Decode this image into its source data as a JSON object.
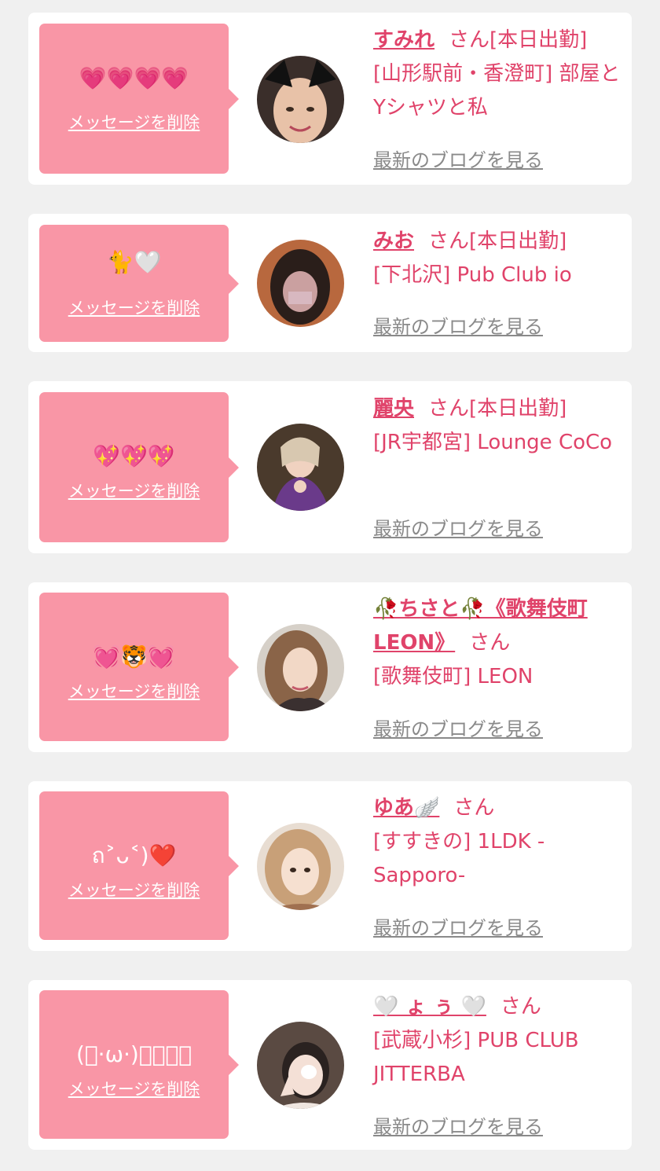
{
  "accent_color": "#e0436a",
  "bubble_color": "#f996a6",
  "cards": [
    {
      "message": "💗💗💗💗",
      "delete_label": "メッセージを削除",
      "name": "すみれ",
      "honorific": "さん",
      "tag": "[本日出勤]",
      "shop": "[山形駅前・香澄町] 部屋とYシャツと私",
      "blog_link": "最新のブログを見る"
    },
    {
      "message": "🐈🤍",
      "delete_label": "メッセージを削除",
      "name": "みお",
      "honorific": "さん",
      "tag": "[本日出勤]",
      "shop": "[下北沢] Pub Club io",
      "blog_link": "最新のブログを見る"
    },
    {
      "message": "💖💖💖",
      "delete_label": "メッセージを削除",
      "name": "麗央",
      "honorific": "さん",
      "tag": "[本日出勤]",
      "shop": "[JR宇都宮] Lounge CoCo",
      "blog_link": "最新のブログを見る"
    },
    {
      "message": "💓🐯💓",
      "delete_label": "メッセージを削除",
      "name": "🥀ちさと🥀《歌舞伎町LEON》",
      "honorific": "さん",
      "tag": "",
      "shop": "[歌舞伎町] LEON",
      "blog_link": "最新のブログを見る"
    },
    {
      "message": "ถ˃ᴗ˂)❤️",
      "delete_label": "メッセージを削除",
      "name": "ゆあ🪽",
      "honorific": "さん",
      "tag": "",
      "shop": "[すすきの] 1LDK -Sapporo-",
      "blog_link": "最新のブログを見る"
    },
    {
      "message": "(ﾟ·ω·)ﾟﾟﾟﾟ",
      "delete_label": "メッセージを削除",
      "name": "🤍 ょ ぅ 🤍",
      "honorific": "さん",
      "tag": "",
      "shop": "[武蔵小杉] PUB CLUB JITTERBA",
      "blog_link": "最新のブログを見る"
    }
  ]
}
